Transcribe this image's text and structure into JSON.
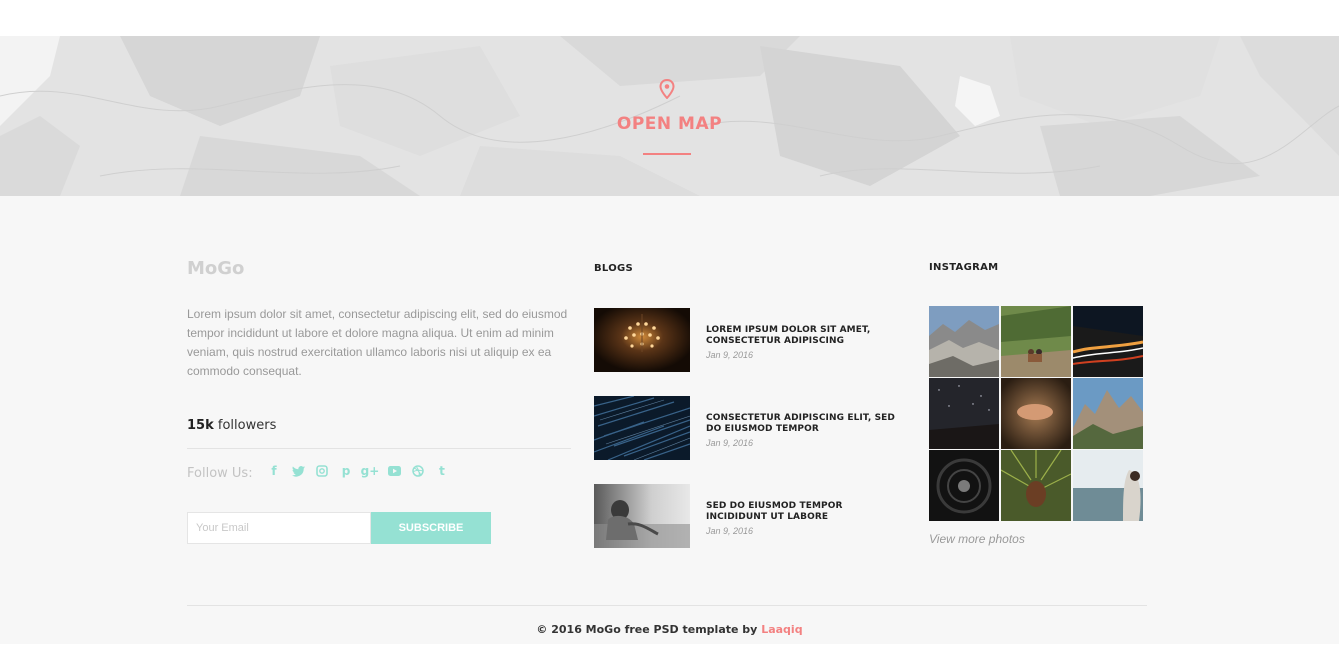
{
  "map": {
    "title": "OPEN MAP",
    "icon": "map-pin-icon",
    "accent": "#f38181"
  },
  "about": {
    "brand": "MoGo",
    "text": "Lorem ipsum dolor sit amet, consectetur adipiscing elit, sed do eiusmod tempor incididunt ut labore et dolore magna aliqua. Ut enim ad minim veniam, quis nostrud exercitation ullamco laboris nisi ut aliquip ex ea commodo consequat.",
    "followers_count": "15k",
    "followers_label": "followers",
    "follow_us": "Follow Us:",
    "social": [
      {
        "name": "facebook-icon",
        "glyph": "f"
      },
      {
        "name": "twitter-icon",
        "glyph": "t"
      },
      {
        "name": "instagram-icon",
        "glyph": "◎"
      },
      {
        "name": "pinterest-icon",
        "glyph": "p"
      },
      {
        "name": "google-plus-icon",
        "glyph": "g+"
      },
      {
        "name": "youtube-icon",
        "glyph": "▶"
      },
      {
        "name": "dribbble-icon",
        "glyph": "⊛"
      },
      {
        "name": "tumblr-icon",
        "glyph": "t"
      }
    ],
    "social_color": "#95e1d3"
  },
  "subscribe": {
    "placeholder": "Your Email",
    "button": "SUBSCRIBE",
    "button_color": "#95e1d3"
  },
  "blogs": {
    "title": "BLOGS",
    "items": [
      {
        "title": "LOREM IPSUM DOLOR SIT AMET, CONSECTETUR ADIPISCING",
        "date": "Jan 9, 2016",
        "image": "chandelier-image"
      },
      {
        "title": "CONSECTETUR ADIPISCING ELIT, SED DO EIUSMOD TEMPOR",
        "date": "Jan 9, 2016",
        "image": "rain-streaks-image"
      },
      {
        "title": "SED DO EIUSMOD TEMPOR INCIDIDUNT UT LABORE",
        "date": "Jan 9, 2016",
        "image": "child-portrait-image"
      }
    ]
  },
  "instagram": {
    "title": "INSTAGRAM",
    "photos": [
      "mountain-valley-photo",
      "couple-cliff-photo",
      "night-road-photo",
      "night-sky-photo",
      "hand-rock-photo",
      "rocky-peaks-photo",
      "tunnel-photo",
      "pine-cone-photo",
      "sea-girl-photo"
    ],
    "view_more": "View more photos"
  },
  "footer": {
    "copyright_prefix": "© 2016 MoGo free PSD template by",
    "author": "Laaqiq",
    "author_color": "#f38181"
  }
}
